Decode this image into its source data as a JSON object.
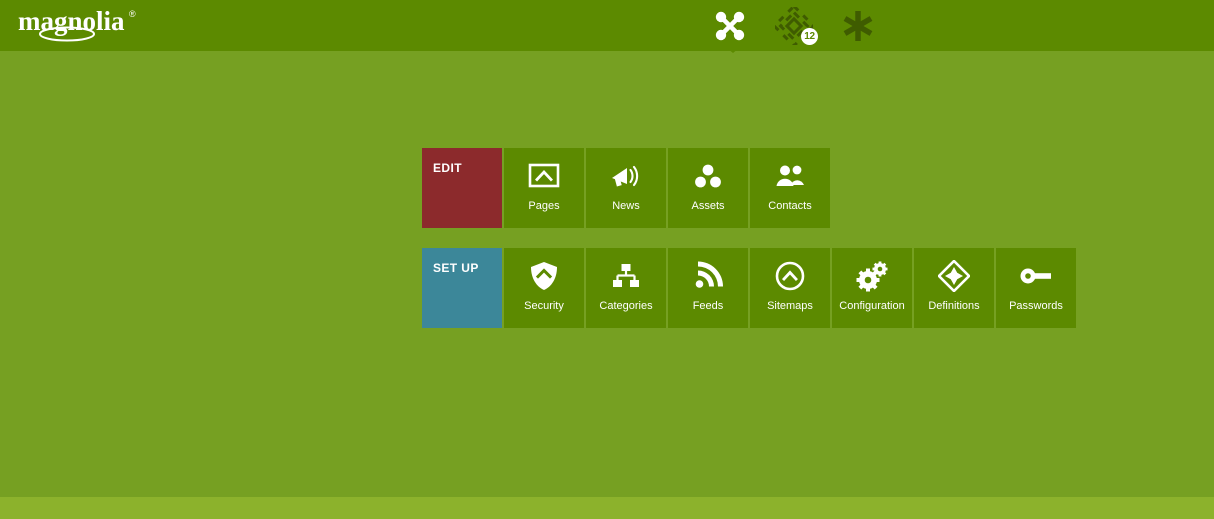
{
  "header": {
    "logo_text": "magnolia",
    "logo_registered_mark": "®",
    "icons": [
      {
        "name": "apps-launcher-icon",
        "label": "Apps",
        "active": true
      },
      {
        "name": "pulse-icon",
        "label": "Pulse",
        "badge": "12"
      },
      {
        "name": "favorites-icon",
        "label": "Favorites"
      }
    ],
    "background_color": "#5c8a00"
  },
  "page": {
    "background_color": "#76a022",
    "bottom_band_color": "#8cb22c"
  },
  "app_launcher": {
    "groups": [
      {
        "name": "edit",
        "label": "EDIT",
        "color": "#8c2a2c",
        "apps": [
          {
            "label": "Pages",
            "icon": "pages-icon"
          },
          {
            "label": "News",
            "icon": "megaphone-icon"
          },
          {
            "label": "Assets",
            "icon": "assets-icon"
          },
          {
            "label": "Contacts",
            "icon": "contacts-icon"
          }
        ]
      },
      {
        "name": "setup",
        "label": "SET UP",
        "color": "#3c8799",
        "apps": [
          {
            "label": "Security",
            "icon": "shield-icon"
          },
          {
            "label": "Categories",
            "icon": "hierarchy-icon"
          },
          {
            "label": "Feeds",
            "icon": "rss-icon"
          },
          {
            "label": "Sitemaps",
            "icon": "circle-chevron-up-icon"
          },
          {
            "label": "Configuration",
            "icon": "gears-icon"
          },
          {
            "label": "Definitions",
            "icon": "diamond-star-icon"
          },
          {
            "label": "Passwords",
            "icon": "key-icon"
          }
        ]
      }
    ],
    "tile_color": "#5c8a00"
  }
}
